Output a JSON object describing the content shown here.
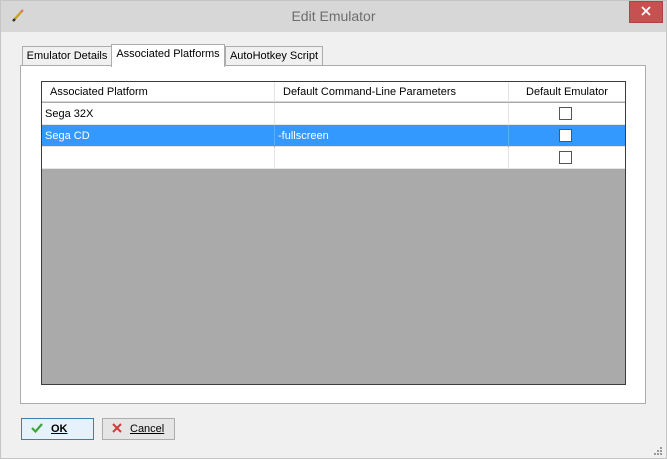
{
  "window": {
    "title": "Edit Emulator",
    "close_glyph": "✕"
  },
  "tabs": [
    {
      "label": "Emulator Details",
      "active": false
    },
    {
      "label": "Associated Platforms",
      "active": true
    },
    {
      "label": "AutoHotkey Script",
      "active": false
    }
  ],
  "grid": {
    "columns": [
      "Associated Platform",
      "Default Command-Line Parameters",
      "Default Emulator"
    ],
    "rows": [
      {
        "platform": "Sega 32X",
        "params": "",
        "default": false,
        "selected": false
      },
      {
        "platform": "Sega CD",
        "params": "-fullscreen",
        "default": false,
        "selected": true
      },
      {
        "platform": "",
        "params": "",
        "default": false,
        "selected": false
      }
    ]
  },
  "buttons": {
    "ok_label": "OK",
    "cancel_label": "Cancel"
  },
  "icons": {
    "app": "pencil-icon",
    "ok": "checkmark-icon",
    "cancel": "x-icon",
    "close": "close-icon",
    "resize": "resize-grip-icon"
  },
  "colors": {
    "selection": "#3399ff",
    "close_button": "#c75050",
    "ok_check": "#3fa535",
    "cancel_x": "#d23c3c",
    "grid_empty_area": "#aaaaaa"
  }
}
